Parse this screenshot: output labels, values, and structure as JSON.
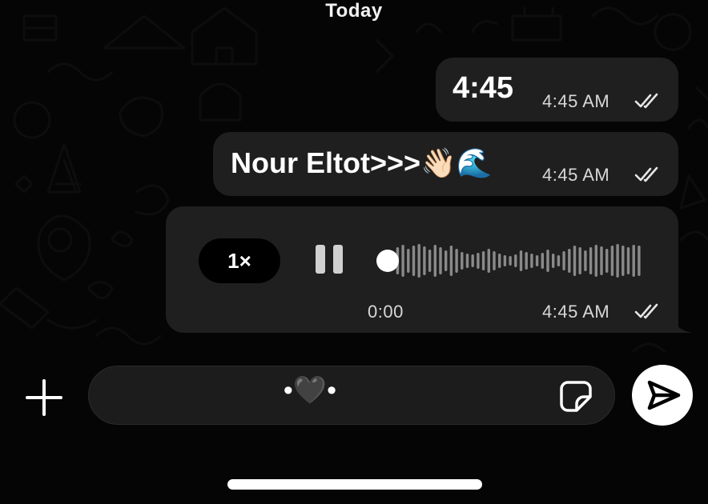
{
  "chat": {
    "date_separator": "Today",
    "messages": [
      {
        "text": "4:45",
        "time": "4:45 AM",
        "status_icon": "double-check-icon"
      },
      {
        "text": "Nour Eltot>>>👋🏻🌊",
        "time": "4:45 AM",
        "status_icon": "double-check-icon"
      }
    ],
    "voice_message": {
      "speed": "1×",
      "elapsed": "0:00",
      "time": "4:45 AM",
      "state": "playing",
      "progress": 0,
      "status_icon": "double-check-icon"
    }
  },
  "composer": {
    "add_icon": "plus-icon",
    "text": "•🖤•",
    "sticker_icon": "sticker-icon",
    "send_icon": "send-icon"
  },
  "colors": {
    "background": "#050505",
    "bubble": "#1f1f1f",
    "input": "#1c1c1c",
    "send_button": "#ffffff"
  }
}
